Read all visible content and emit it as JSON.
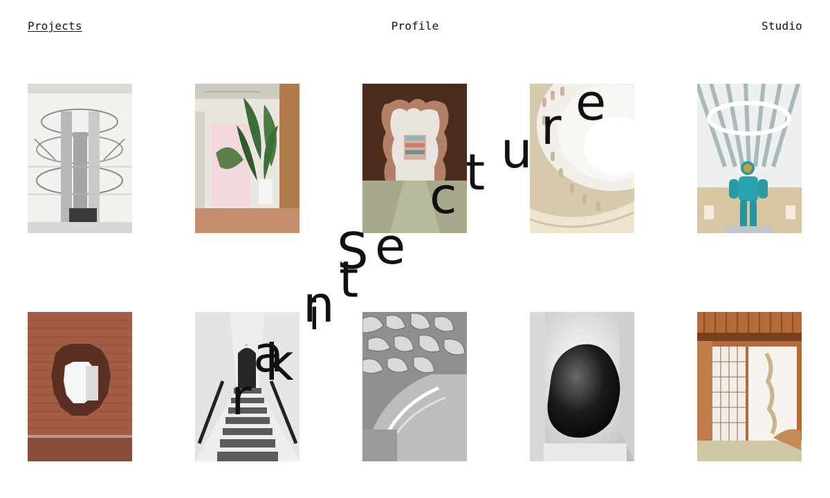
{
  "nav": {
    "projects": "Projects",
    "profile": "Profile",
    "studio": "Studio"
  },
  "letters": [
    {
      "char": "c"
    },
    {
      "char": "t"
    },
    {
      "char": "u"
    },
    {
      "char": "r"
    },
    {
      "char": "e"
    },
    {
      "char": "S"
    },
    {
      "char": "e"
    },
    {
      "char": "t"
    },
    {
      "char": "n"
    },
    {
      "char": "i"
    },
    {
      "char": "a"
    },
    {
      "char": "k"
    },
    {
      "char": "r"
    }
  ]
}
